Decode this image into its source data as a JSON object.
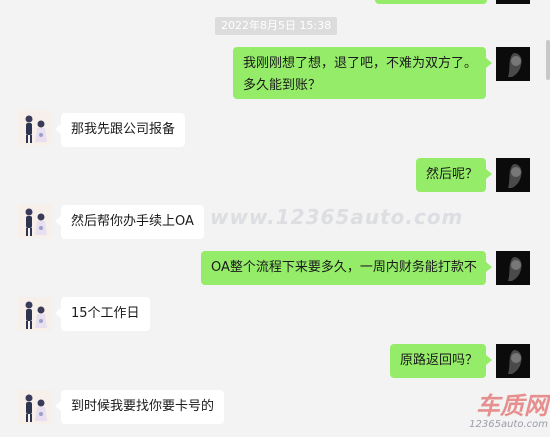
{
  "timestamp": "2022年8月5日 15:38",
  "watermark": "www.12365auto.com",
  "logo": {
    "name": "车质网",
    "url": "12365auto.com"
  },
  "colors": {
    "sent_bubble": "#95ec69",
    "received_bubble": "#ffffff",
    "background": "#f3f3f3"
  },
  "messages": [
    {
      "from": "me",
      "line1": "我刚刚想了想，退了吧，不难为双方了。",
      "line2": "多久能到账？"
    },
    {
      "from": "other",
      "text": "那我先跟公司报备"
    },
    {
      "from": "me",
      "text": "然后呢？"
    },
    {
      "from": "other",
      "text": "然后帮你办手续上OA"
    },
    {
      "from": "me",
      "text": "OA整个流程下来要多久，一周内财务能打款不"
    },
    {
      "from": "other",
      "text": "15个工作日"
    },
    {
      "from": "me",
      "text": "原路返回吗？"
    },
    {
      "from": "other",
      "text": "到时候我要找你要卡号的"
    }
  ]
}
